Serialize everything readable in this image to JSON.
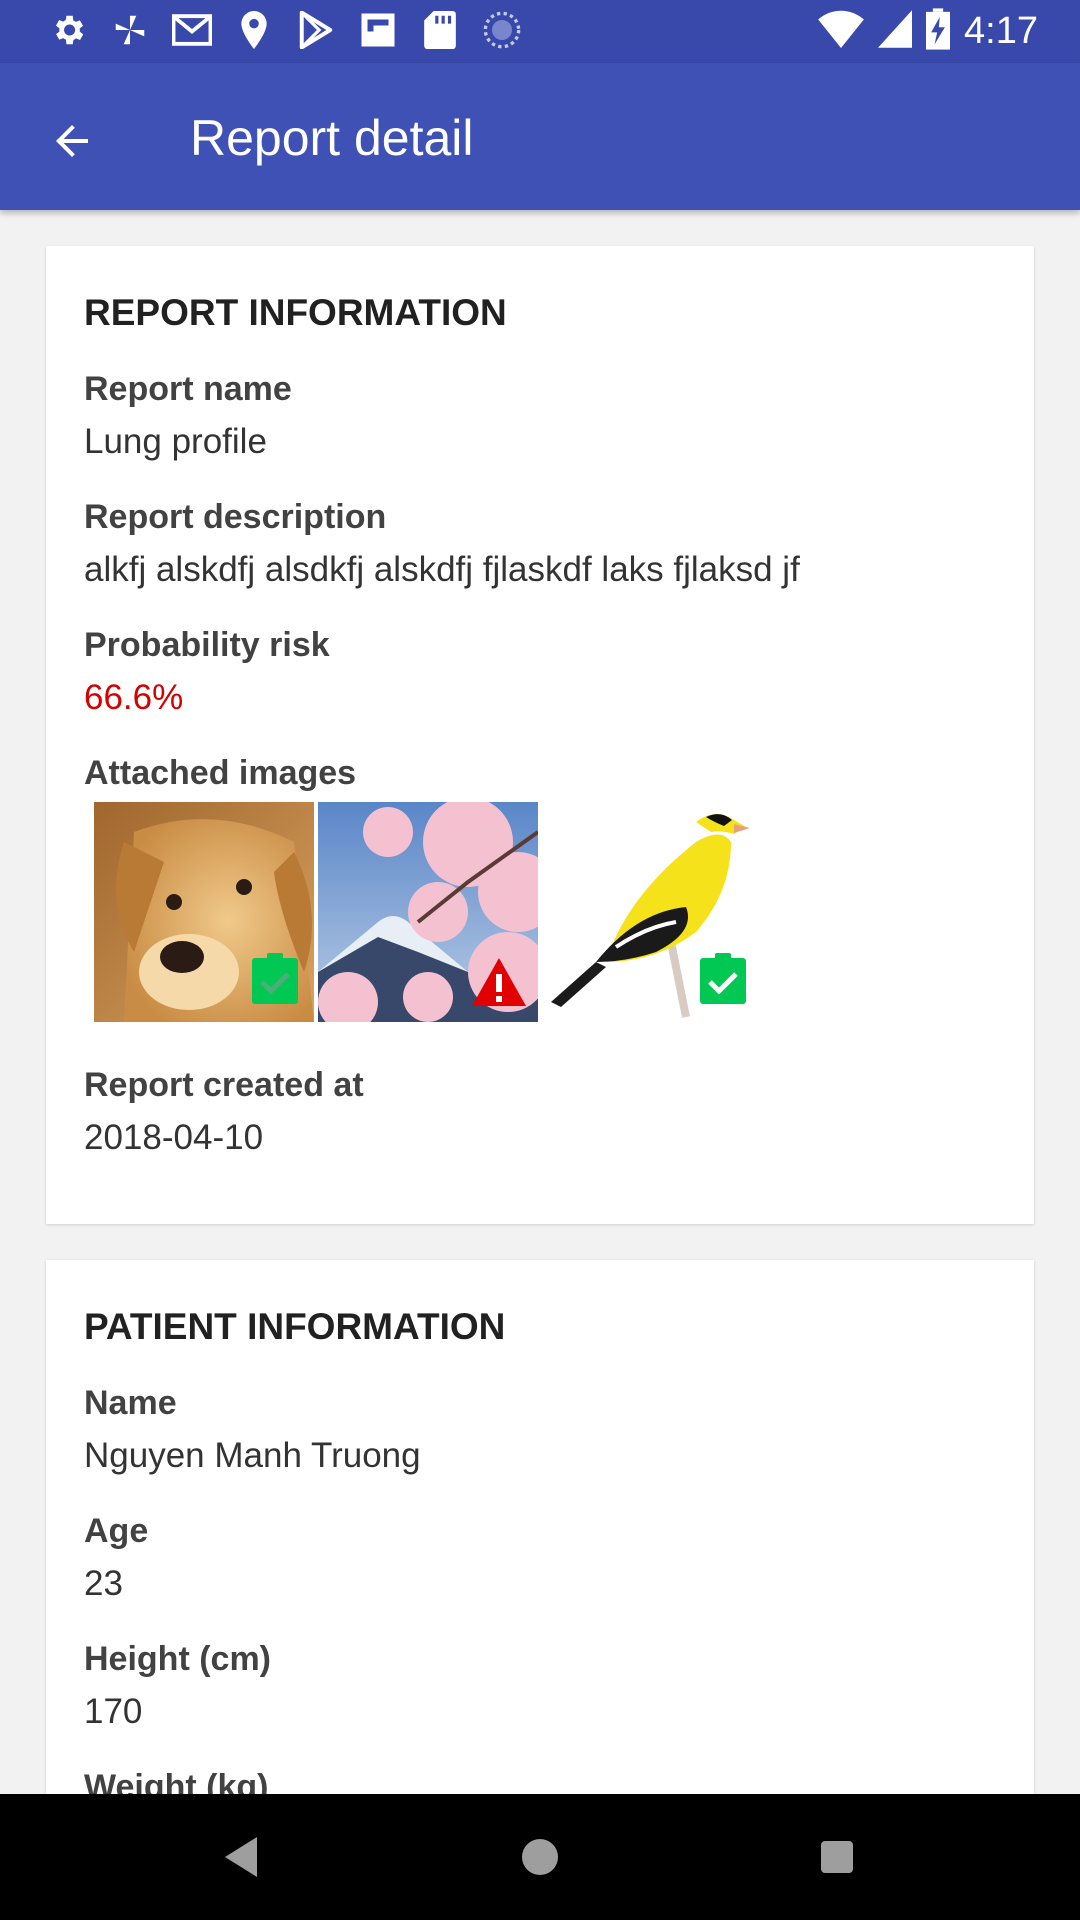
{
  "status_bar": {
    "time": "4:17",
    "left_icons": [
      "settings-icon",
      "pinwheel-icon",
      "gmail-icon",
      "location-icon",
      "play-store-icon",
      "flipboard-icon",
      "sd-card-icon",
      "sync-circle-icon"
    ],
    "right_icons": [
      "wifi-icon",
      "signal-icon",
      "battery-charging-icon"
    ]
  },
  "app_bar": {
    "title": "Report detail",
    "back_icon": "arrow-back-icon",
    "color": "#3f51b5"
  },
  "report_info": {
    "section_title": "REPORT INFORMATION",
    "report_name_label": "Report name",
    "report_name_value": "Lung profile",
    "report_description_label": "Report description",
    "report_description_value": "alkfj alskdfj alsdkfj alskdfj fjlaskdf laks fjlaksd jf",
    "probability_risk_label": "Probability risk",
    "probability_risk_value": "66.6%",
    "risk_color": "#d50000",
    "attached_images_label": "Attached images",
    "images": [
      {
        "subject": "golden retriever dog",
        "status_icon": "clipboard-check-icon"
      },
      {
        "subject": "cherry blossom and mountain",
        "status_icon": "warning-icon"
      },
      {
        "subject": "yellow goldfinch bird",
        "status_icon": "clipboard-check-icon"
      }
    ],
    "report_created_label": "Report created at",
    "report_created_value": "2018-04-10"
  },
  "patient_info": {
    "section_title": "PATIENT INFORMATION",
    "name_label": "Name",
    "name_value": "Nguyen Manh Truong",
    "age_label": "Age",
    "age_value": "23",
    "height_label": "Height (cm)",
    "height_value": "170",
    "weight_label": "Weight (kg)"
  },
  "nav_bar": {
    "icons": [
      "back-triangle-icon",
      "home-circle-icon",
      "recents-square-icon"
    ]
  }
}
